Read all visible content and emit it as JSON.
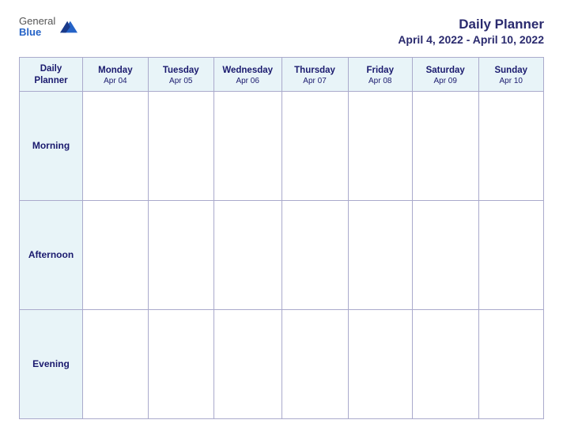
{
  "header": {
    "logo": {
      "general": "General",
      "blue": "Blue",
      "icon_title": "GeneralBlue logo"
    },
    "title": "Daily Planner",
    "date_range": "April 4, 2022 - April 10, 2022"
  },
  "table": {
    "label_column": {
      "header": {
        "line1": "Daily",
        "line2": "Planner"
      },
      "rows": [
        "Morning",
        "Afternoon",
        "Evening"
      ]
    },
    "days": [
      {
        "name": "Monday",
        "date": "Apr 04"
      },
      {
        "name": "Tuesday",
        "date": "Apr 05"
      },
      {
        "name": "Wednesday",
        "date": "Apr 06"
      },
      {
        "name": "Thursday",
        "date": "Apr 07"
      },
      {
        "name": "Friday",
        "date": "Apr 08"
      },
      {
        "name": "Saturday",
        "date": "Apr 09"
      },
      {
        "name": "Sunday",
        "date": "Apr 10"
      }
    ]
  }
}
